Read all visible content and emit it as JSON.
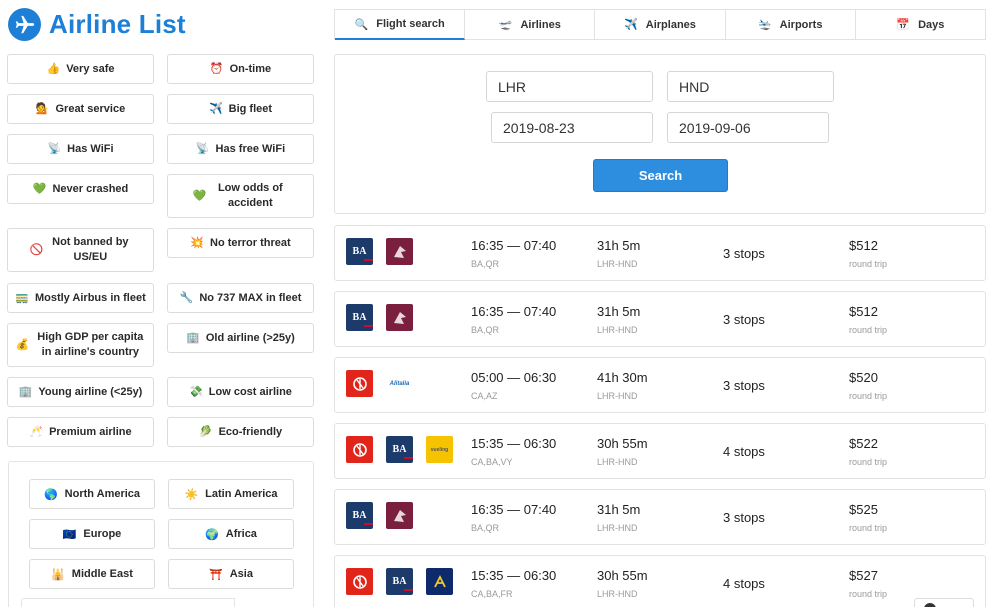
{
  "app": {
    "title": "Airline List"
  },
  "filters": [
    {
      "emoji": "👍",
      "label": "Very safe"
    },
    {
      "emoji": "⏰",
      "label": "On-time"
    },
    {
      "emoji": "💁",
      "label": "Great service"
    },
    {
      "emoji": "✈️",
      "label": "Big fleet"
    },
    {
      "emoji": "📡",
      "label": "Has WiFi"
    },
    {
      "emoji": "📡",
      "label": "Has free WiFi"
    },
    {
      "emoji": "💚",
      "label": "Never crashed"
    },
    {
      "emoji": "💚",
      "label": "Low odds of accident"
    },
    {
      "emoji": "🚫",
      "label": "Not banned by US/EU"
    },
    {
      "emoji": "💥",
      "label": "No terror threat"
    },
    {
      "emoji": "🚃",
      "label": "Mostly Airbus in fleet"
    },
    {
      "emoji": "🔧",
      "label": "No 737 MAX in fleet"
    },
    {
      "emoji": "💰",
      "label": "High GDP per capita in airline's country"
    },
    {
      "emoji": "🏢",
      "label": "Old airline (>25y)"
    },
    {
      "emoji": "🏢",
      "label": "Young airline (<25y)"
    },
    {
      "emoji": "💸",
      "label": "Low cost airline"
    },
    {
      "emoji": "🥂",
      "label": "Premium airline"
    },
    {
      "emoji": "🥬",
      "label": "Eco-friendly"
    }
  ],
  "regions": [
    {
      "emoji": "🌎",
      "label": "North America"
    },
    {
      "emoji": "☀️",
      "label": "Latin America"
    },
    {
      "emoji": "🇪🇺",
      "label": "Europe"
    },
    {
      "emoji": "🌍",
      "label": "Africa"
    },
    {
      "emoji": "🕌",
      "label": "Middle East"
    },
    {
      "emoji": "⛩️",
      "label": "Asia"
    }
  ],
  "tabs": [
    {
      "icon": "🔍",
      "label": "Flight search",
      "active": true
    },
    {
      "icon": "🛫",
      "label": "Airlines",
      "active": false
    },
    {
      "icon": "✈️",
      "label": "Airplanes",
      "active": false
    },
    {
      "icon": "🛬",
      "label": "Airports",
      "active": false
    },
    {
      "icon": "📅",
      "label": "Days",
      "active": false
    }
  ],
  "search": {
    "from": "LHR",
    "to": "HND",
    "depart": "2019-08-23",
    "return": "2019-09-06",
    "button": "Search"
  },
  "results": [
    {
      "logos": [
        "BA",
        "QR"
      ],
      "times": "16:35 — 07:40",
      "codes": "BA,QR",
      "duration": "31h 5m",
      "route": "LHR-HND",
      "stops": "3 stops",
      "price": "$512",
      "price_note": "round trip"
    },
    {
      "logos": [
        "BA",
        "QR"
      ],
      "times": "16:35 — 07:40",
      "codes": "BA,QR",
      "duration": "31h 5m",
      "route": "LHR-HND",
      "stops": "3 stops",
      "price": "$512",
      "price_note": "round trip"
    },
    {
      "logos": [
        "CA",
        "AZ"
      ],
      "times": "05:00 — 06:30",
      "codes": "CA,AZ",
      "duration": "41h 30m",
      "route": "LHR-HND",
      "stops": "3 stops",
      "price": "$520",
      "price_note": "round trip"
    },
    {
      "logos": [
        "CA",
        "BA",
        "VY"
      ],
      "times": "15:35 — 06:30",
      "codes": "CA,BA,VY",
      "duration": "30h 55m",
      "route": "LHR-HND",
      "stops": "4 stops",
      "price": "$522",
      "price_note": "round trip"
    },
    {
      "logos": [
        "BA",
        "QR"
      ],
      "times": "16:35 — 07:40",
      "codes": "BA,QR",
      "duration": "31h 5m",
      "route": "LHR-HND",
      "stops": "3 stops",
      "price": "$525",
      "price_note": "round trip"
    },
    {
      "logos": [
        "CA",
        "BA",
        "FR"
      ],
      "times": "15:35 — 06:30",
      "codes": "CA,BA,FR",
      "duration": "30h 55m",
      "route": "LHR-HND",
      "stops": "4 stops",
      "price": "$527",
      "price_note": "round trip"
    }
  ],
  "logo_text": {
    "BA": "BA",
    "AZ": "Alitalia",
    "VY": "vueling"
  },
  "colors": {
    "accent": "#1e7fd6",
    "button": "#2d8ee0"
  }
}
